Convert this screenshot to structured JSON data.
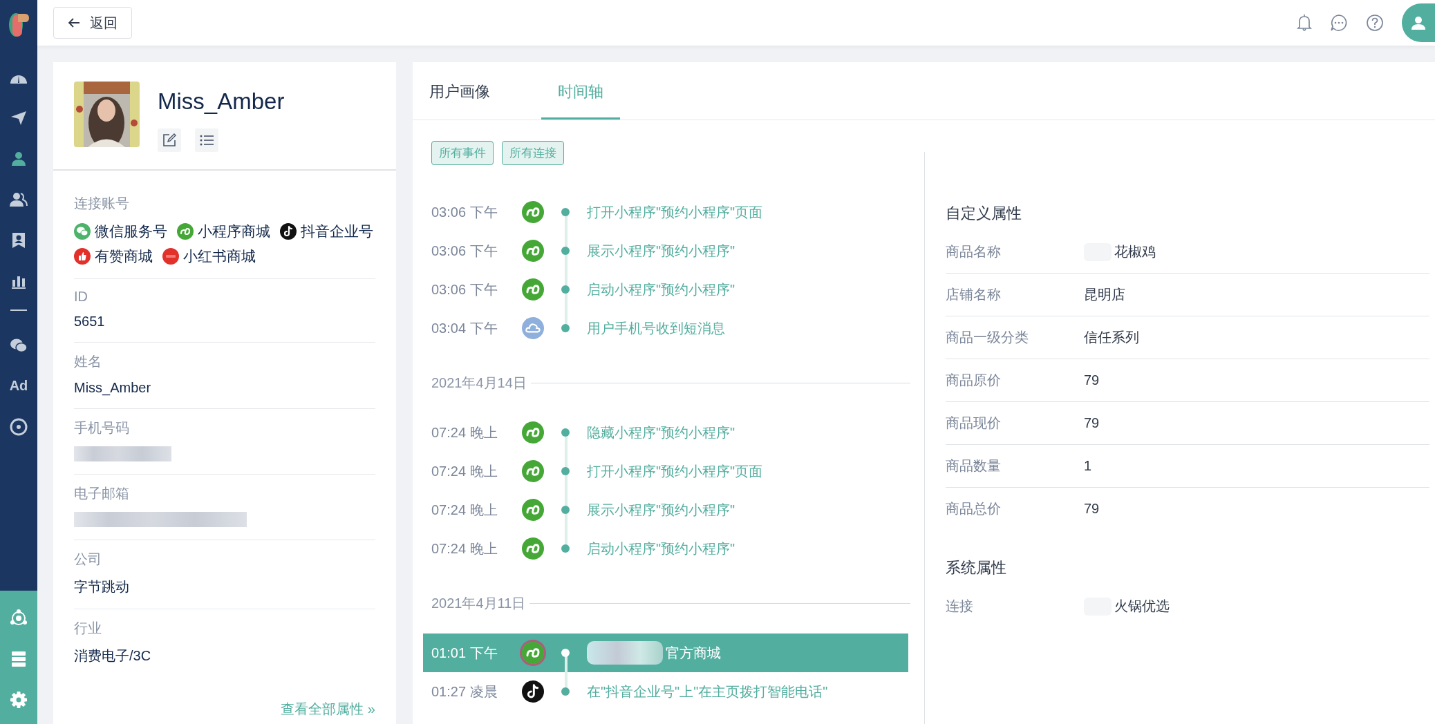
{
  "nav": {
    "items": [
      {
        "kind": "dashboard",
        "selected": false
      },
      {
        "kind": "send",
        "selected": false
      },
      {
        "kind": "user",
        "selected": true
      },
      {
        "kind": "users",
        "selected": false
      },
      {
        "kind": "contact",
        "selected": false
      },
      {
        "kind": "chart",
        "selected": false
      },
      {
        "kind": "divider"
      },
      {
        "kind": "wechat",
        "selected": false
      },
      {
        "kind": "text",
        "label": "Ad",
        "selected": false
      },
      {
        "kind": "target",
        "selected": false
      }
    ],
    "bottom": [
      {
        "kind": "hub"
      },
      {
        "kind": "server"
      },
      {
        "kind": "settings"
      }
    ]
  },
  "back_button": "返回",
  "profile": {
    "name": "Miss_Amber",
    "accounts_label": "连接账号",
    "accounts": [
      {
        "kind": "wechat",
        "label": "微信服务号"
      },
      {
        "kind": "miniprogram",
        "label": "小程序商城"
      },
      {
        "kind": "tiktok",
        "label": "抖音企业号"
      },
      {
        "kind": "youzan",
        "label": "有赞商城"
      },
      {
        "kind": "xiaohongshu",
        "label": "小红书商城"
      }
    ],
    "fields": [
      {
        "kind": "text",
        "label": "ID",
        "value": "5651"
      },
      {
        "kind": "text",
        "label": "姓名",
        "value": "Miss_Amber"
      },
      {
        "kind": "phone",
        "label": "手机号码",
        "masked": true
      },
      {
        "kind": "email",
        "label": "电子邮箱",
        "masked": true
      },
      {
        "kind": "text",
        "label": "公司",
        "value": "字节跳动"
      },
      {
        "kind": "text",
        "label": "行业",
        "value": "消费电子/3C"
      }
    ],
    "view_all": "查看全部属性 »"
  },
  "tabs": [
    {
      "label": "用户画像",
      "selected": false
    },
    {
      "label": "时间轴",
      "selected": true
    }
  ],
  "filters": [
    "所有事件",
    "所有连接"
  ],
  "timeline": [
    {
      "events": [
        {
          "time": "03:06 下午",
          "kind": "miniprogram",
          "text": "打开小程序\"预约小程序\"页面",
          "selected": false
        },
        {
          "time": "03:06 下午",
          "kind": "miniprogram",
          "text": "展示小程序\"预约小程序\"",
          "selected": false
        },
        {
          "time": "03:06 下午",
          "kind": "miniprogram",
          "text": "启动小程序\"预约小程序\"",
          "selected": false
        },
        {
          "time": "03:04 下午",
          "kind": "sms",
          "text": "用户手机号收到短消息",
          "selected": false
        }
      ]
    },
    {
      "date": "2021年4月14日",
      "events": [
        {
          "time": "07:24 晚上",
          "kind": "miniprogram",
          "text": "隐藏小程序\"预约小程序\"",
          "selected": false
        },
        {
          "time": "07:24 晚上",
          "kind": "miniprogram",
          "text": "打开小程序\"预约小程序\"页面",
          "selected": false
        },
        {
          "time": "07:24 晚上",
          "kind": "miniprogram",
          "text": "展示小程序\"预约小程序\"",
          "selected": false
        },
        {
          "time": "07:24 晚上",
          "kind": "miniprogram",
          "text": "启动小程序\"预约小程序\"",
          "selected": false
        }
      ]
    },
    {
      "date": "2021年4月11日",
      "events": [
        {
          "time": "01:01 下午",
          "kind": "miniprogram",
          "text": "官方商城",
          "masked": true,
          "selected": true
        },
        {
          "time": "01:27 凌晨",
          "kind": "tiktok",
          "text": "在\"抖音企业号\"上\"在主页拨打智能电话\"",
          "selected": false
        }
      ]
    }
  ],
  "custom_properties": {
    "title": "自定义属性",
    "rows": [
      {
        "label": "商品名称",
        "value": "花椒鸡",
        "masked": true
      },
      {
        "label": "店铺名称",
        "value": "昆明店"
      },
      {
        "label": "商品一级分类",
        "value": "信任系列"
      },
      {
        "label": "商品原价",
        "value": "79"
      },
      {
        "label": "商品现价",
        "value": "79"
      },
      {
        "label": "商品数量",
        "value": "1"
      },
      {
        "label": "商品总价",
        "value": "79"
      }
    ]
  },
  "system_properties": {
    "title": "系统属性",
    "rows": [
      {
        "label": "连接",
        "value": "火锅优选",
        "masked": true
      }
    ]
  }
}
